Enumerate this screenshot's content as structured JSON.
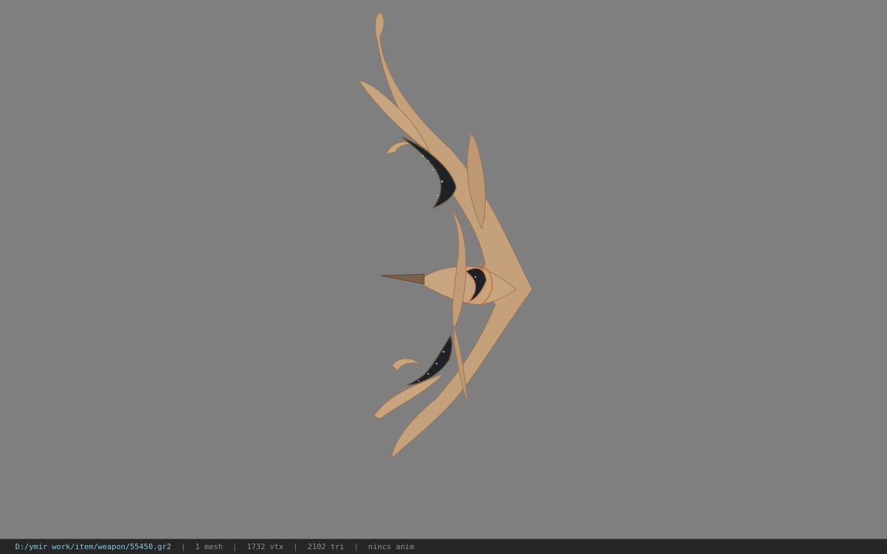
{
  "viewport": {
    "background_color": "#7f7f7f",
    "model": {
      "name": "bow-model",
      "material_color": "#c9a47e",
      "inlay_color": "#1e2226",
      "accent_color": "#d07a45"
    }
  },
  "statusbar": {
    "file_path": "D:/ymir work/item/weapon/55450.gr2",
    "separator": "|",
    "mesh_count": "1 mesh",
    "vertex_count": "1732 vtx",
    "triangle_count": "2102 tri",
    "animation": "nincs anim",
    "path_color": "#86c4de"
  }
}
